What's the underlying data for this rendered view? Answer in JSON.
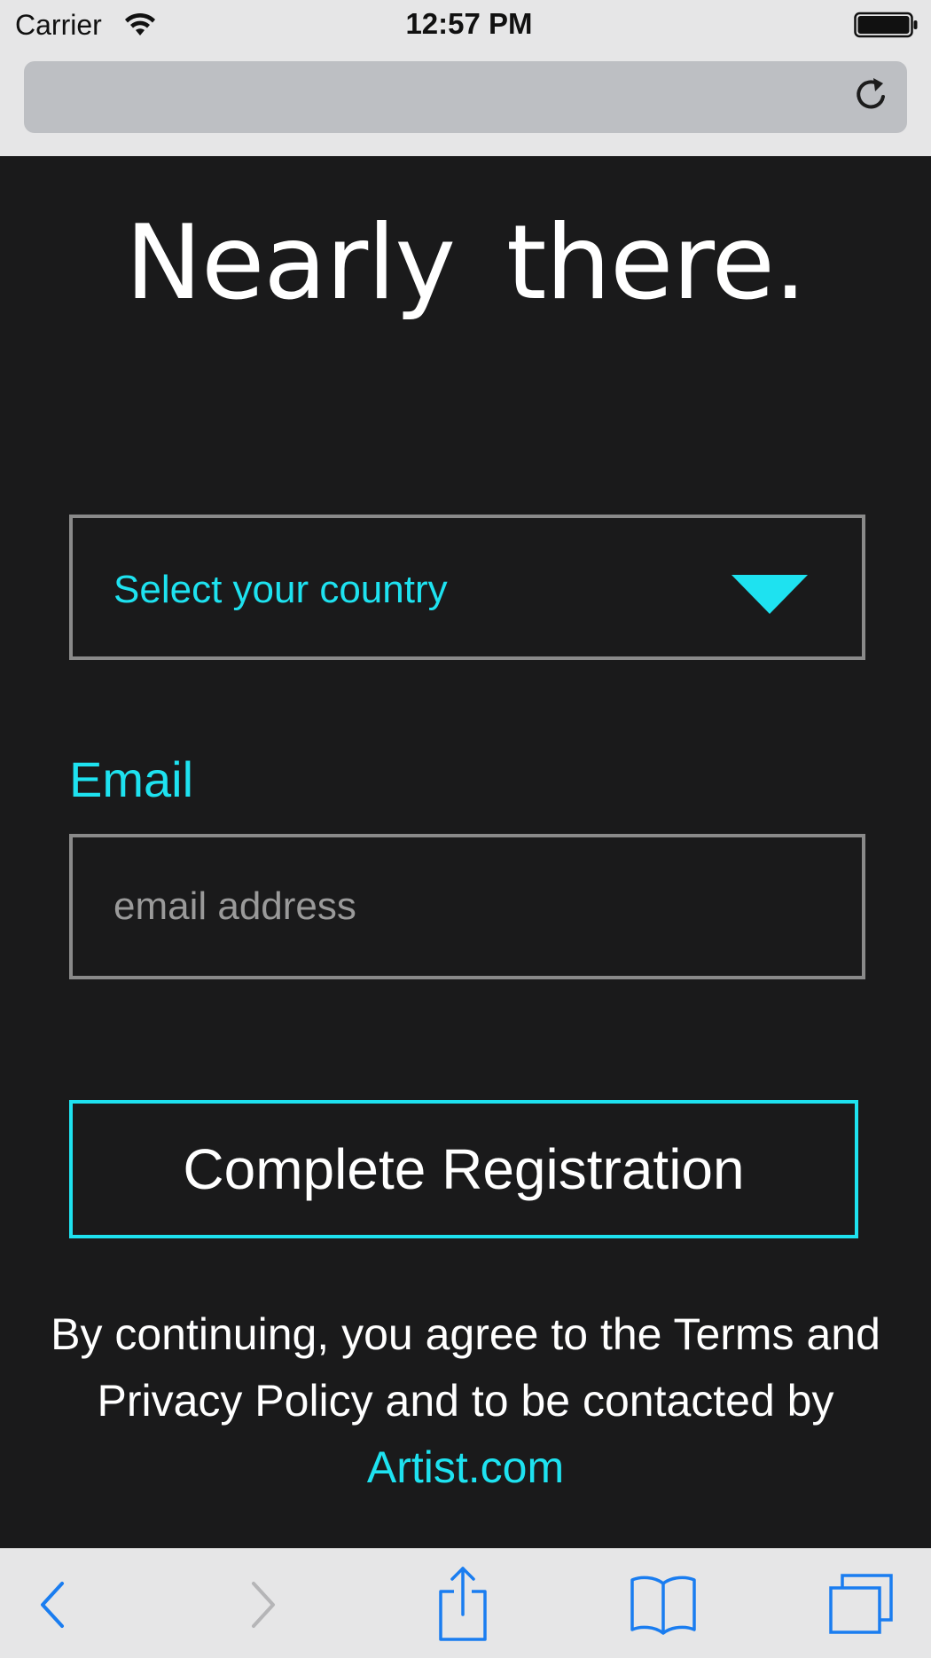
{
  "status_bar": {
    "carrier": "Carrier",
    "time": "12:57 PM",
    "wifi_icon": "wifi-icon",
    "battery_icon": "battery-icon"
  },
  "browser": {
    "reload_icon": "reload-icon",
    "toolbar_icons": [
      "back-icon",
      "forward-icon",
      "share-icon",
      "bookmarks-icon",
      "tabs-icon"
    ],
    "accent_color": "#1a7df0"
  },
  "page": {
    "title": "Nearly there.",
    "country_select": {
      "value": "Select your country",
      "icon": "dropdown-triangle-icon"
    },
    "email": {
      "label": "Email",
      "placeholder": "email address",
      "value": ""
    },
    "submit_label": "Complete Registration",
    "terms": {
      "text": "By continuing, you agree to the Terms and Privacy Policy and to be contacted by ",
      "link_label": "Artist.com"
    },
    "colors": {
      "background": "#1a1a1b",
      "accent": "#1ee2f0",
      "border": "#8a8a8a",
      "text": "#ffffff"
    }
  }
}
